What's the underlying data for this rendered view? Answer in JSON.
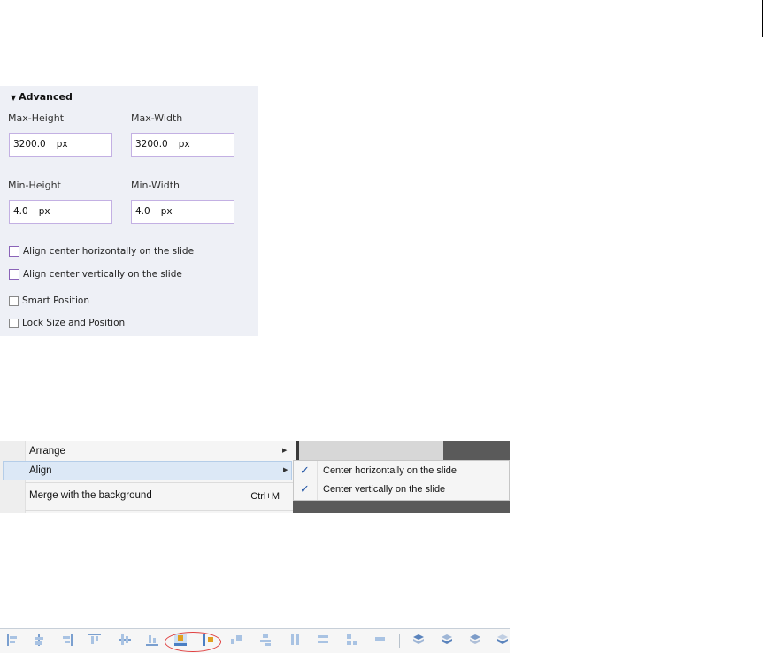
{
  "advanced": {
    "title": "Advanced",
    "max_height": {
      "label": "Max-Height",
      "value": "3200.0",
      "unit": "px"
    },
    "max_width": {
      "label": "Max-Width",
      "value": "3200.0",
      "unit": "px"
    },
    "min_height": {
      "label": "Min-Height",
      "value": "4.0",
      "unit": "px"
    },
    "min_width": {
      "label": "Min-Width",
      "value": "4.0",
      "unit": "px"
    },
    "checkboxes": [
      {
        "label": "Align center horizontally on the slide",
        "checked": false
      },
      {
        "label": "Align center vertically on the slide",
        "checked": false
      },
      {
        "label": "Smart Position",
        "checked": false
      },
      {
        "label": "Lock Size and Position",
        "checked": false
      }
    ]
  },
  "context_menu": {
    "items": [
      {
        "label": "Arrange"
      },
      {
        "label": "Align"
      },
      {
        "label": "Merge with the background",
        "shortcut": "Ctrl+M"
      }
    ],
    "submenu": [
      {
        "label": "Center horizontally on the slide",
        "checked": true
      },
      {
        "label": "Center vertically on the slide",
        "checked": true
      }
    ]
  },
  "toolbar": {
    "buttons": [
      "align-left-icon",
      "align-center-icon",
      "align-right-icon",
      "align-top-icon",
      "align-middle-icon",
      "align-bottom-icon",
      "center-horizontally-icon",
      "center-vertically-icon",
      "distribute-horizontal-icon",
      "distribute-vertical-icon",
      "same-width-icon",
      "same-height-icon",
      "same-size-icon",
      "position-icon",
      "bring-to-front-icon",
      "bring-forward-icon",
      "send-backward-icon",
      "send-to-back-icon"
    ],
    "highlighted": [
      "center-horizontally-icon",
      "center-vertically-icon"
    ],
    "highlight_color": "#e04040"
  }
}
